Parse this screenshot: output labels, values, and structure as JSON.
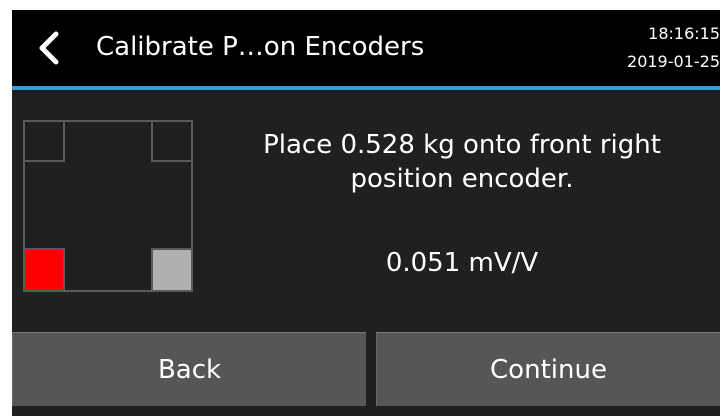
{
  "header": {
    "title": "Calibrate P…on Encoders",
    "time": "18:16:15",
    "date": "2019-01-25",
    "back_icon": "chevron-left-icon",
    "accent_color": "#3a9ad6"
  },
  "encoder_diagram": {
    "positions": [
      {
        "name": "rear-left",
        "state": "empty"
      },
      {
        "name": "rear-right",
        "state": "empty"
      },
      {
        "name": "front-left",
        "state": "error",
        "color": "#ff0000"
      },
      {
        "name": "front-right",
        "state": "active",
        "color": "#b0b0b0"
      }
    ]
  },
  "instruction": {
    "message": "Place 0.528 kg onto front right position encoder.",
    "reading": "0.051 mV/V"
  },
  "buttons": {
    "back_label": "Back",
    "continue_label": "Continue"
  }
}
